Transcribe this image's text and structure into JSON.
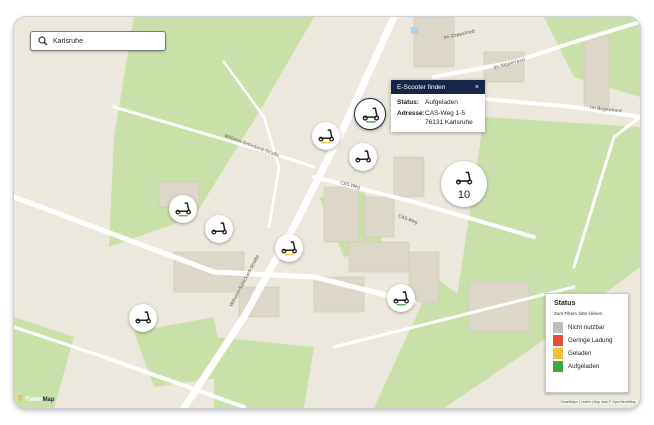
{
  "search": {
    "value": "Karlsruhe",
    "icon": "search-icon"
  },
  "streets": {
    "wilhelm_schickard_1": "Wilhelm-Schickard-Straße",
    "wilhelm_schickard_2": "Wilhelm-Schickard-Straße",
    "cas_weg_1": "CAS-Weg",
    "cas_weg_2": "CAS-Weg",
    "im_zoppelried": "Im Zoppelried",
    "im_nipperrand": "Im Nipperrand",
    "im_bogenhard": "Im Bogenhard"
  },
  "popup": {
    "title": "E-Scooter finden",
    "close": "×",
    "status_label": "Status:",
    "status_value": "Aufgeladen",
    "address_label": "Adresse:",
    "address_line1": "CAS-Weg 1-5",
    "address_line2": "76131 Karlsruhe"
  },
  "cluster": {
    "count": "10"
  },
  "legend": {
    "title": "Status",
    "hint": "Zum Filtern bitte klicken",
    "items": [
      {
        "label": "Nicht nutzbar",
        "color": "#bdbdbd"
      },
      {
        "label": "Geringe Ladung",
        "color": "#e74c3c"
      },
      {
        "label": "Geladen",
        "color": "#f2c233"
      },
      {
        "label": "Aufgeladen",
        "color": "#3fa642"
      }
    ]
  },
  "logo": {
    "part1": "Tiefen",
    "part2": "Map"
  },
  "attribution": "SmartMaps | Leaflet | Map data © OpenStreetMap",
  "colors": {
    "background": "#ede8dd",
    "green": "#c9e0a8",
    "building": "#ddd7ca",
    "road": "#ffffff",
    "popup_header": "#18254a"
  }
}
